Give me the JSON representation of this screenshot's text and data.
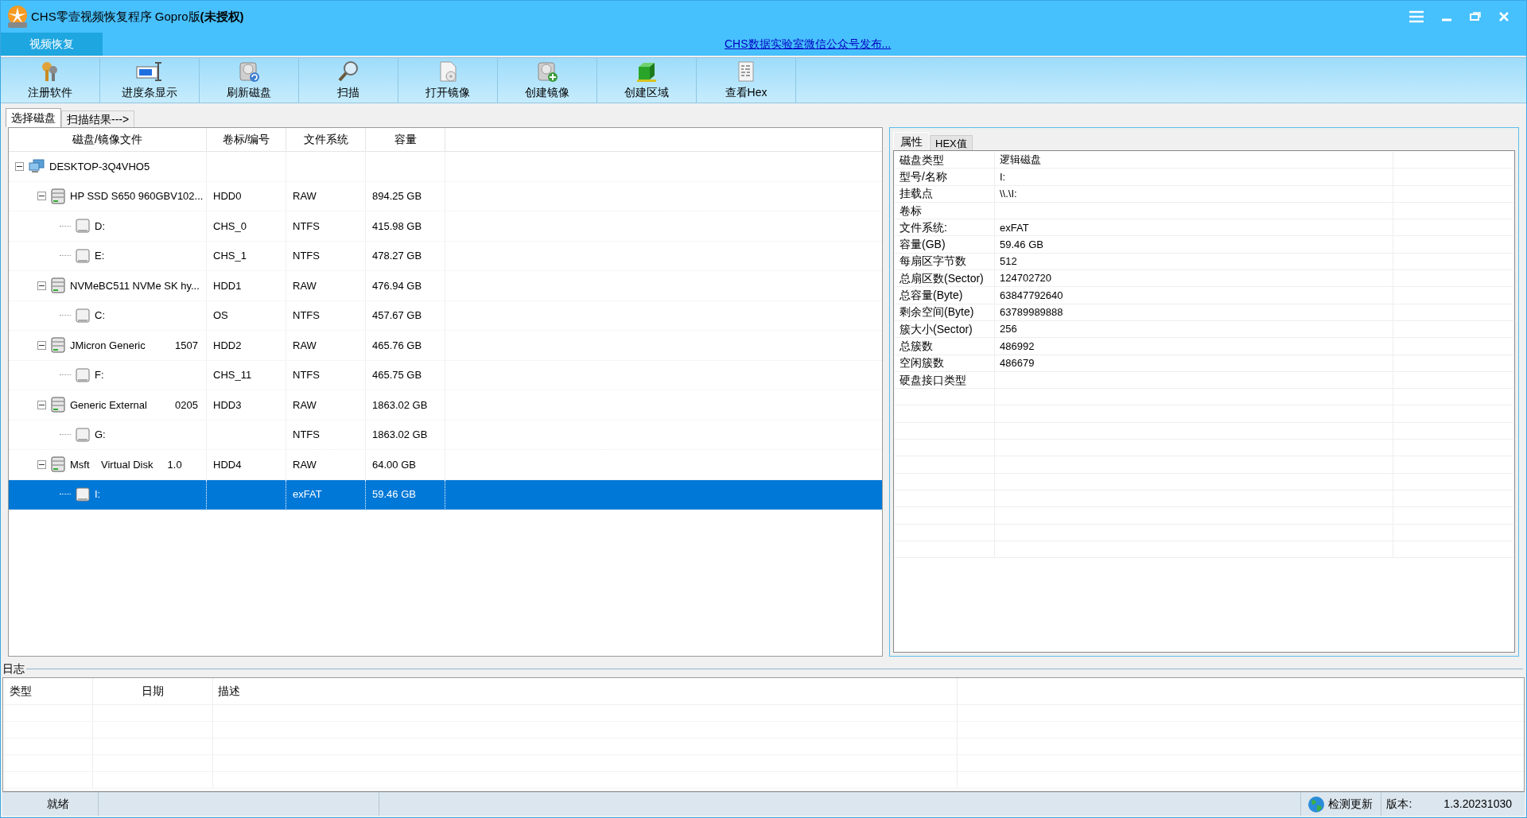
{
  "window": {
    "title": "CHS零壹视频恢复程序 Gopro版",
    "title_suffix": "(未授权)"
  },
  "nav_tabs": [
    {
      "label": "视频恢复",
      "selected": true
    }
  ],
  "link": "CHS数据实验室微信公众号发布...",
  "toolbar": [
    "注册软件",
    "进度条显示",
    "刷新磁盘",
    "扫描",
    "打开镜像",
    "创建镜像",
    "创建区域",
    "查看Hex"
  ],
  "tabs": [
    {
      "label": "选择磁盘",
      "selected": true
    },
    {
      "label": "扫描结果--->",
      "selected": false
    }
  ],
  "disk_table": {
    "columns": [
      "磁盘/镜像文件",
      "卷标/编号",
      "文件系统",
      "容量"
    ],
    "tree": [
      {
        "kind": "computer",
        "name": "DESKTOP-3Q4VHO5",
        "expanded": true,
        "selected": false,
        "children": [
          {
            "kind": "disk",
            "name": "HP SSD S650 960GBV102...",
            "label": "HDD0",
            "fs": "RAW",
            "size": "894.25 GB",
            "expanded": true,
            "selected": false,
            "children": [
              {
                "kind": "volume",
                "name": "D:",
                "label": "CHS_0",
                "fs": "NTFS",
                "size": "415.98 GB",
                "selected": false
              },
              {
                "kind": "volume",
                "name": "E:",
                "label": "CHS_1",
                "fs": "NTFS",
                "size": "478.27 GB",
                "selected": false
              }
            ]
          },
          {
            "kind": "disk",
            "name": "NVMeBC511 NVMe SK hy...",
            "label": "HDD1",
            "fs": "RAW",
            "size": "476.94 GB",
            "expanded": true,
            "selected": false,
            "children": [
              {
                "kind": "volume",
                "name": "C:",
                "label": "OS",
                "fs": "NTFS",
                "size": "457.67 GB",
                "selected": false
              }
            ]
          },
          {
            "kind": "disk",
            "name": "JMicron Generic",
            "name_suffix": "1507",
            "label": "HDD2",
            "fs": "RAW",
            "size": "465.76 GB",
            "expanded": true,
            "selected": false,
            "children": [
              {
                "kind": "volume",
                "name": "F:",
                "label": "CHS_11",
                "fs": "NTFS",
                "size": "465.75 GB",
                "selected": false
              }
            ]
          },
          {
            "kind": "disk",
            "name": "Generic External",
            "name_suffix": "0205",
            "label": "HDD3",
            "fs": "RAW",
            "size": "1863.02 GB",
            "expanded": true,
            "selected": false,
            "children": [
              {
                "kind": "volume",
                "name": "G:",
                "fs": "NTFS",
                "size": "1863.02 GB",
                "selected": false
              }
            ]
          },
          {
            "kind": "disk",
            "name": "Msft    Virtual Disk     1.0",
            "label": "HDD4",
            "fs": "RAW",
            "size": "64.00 GB",
            "expanded": true,
            "selected": false,
            "children": [
              {
                "kind": "volume",
                "name": "I:",
                "fs": "exFAT",
                "size": "59.46 GB",
                "selected": true
              }
            ]
          }
        ]
      }
    ]
  },
  "detail_tabs": [
    {
      "label": "属性",
      "selected": true
    },
    {
      "label": "HEX值",
      "selected": false
    }
  ],
  "properties": [
    {
      "name": "磁盘类型",
      "value": "逻辑磁盘"
    },
    {
      "name": "型号/名称",
      "value": "I:"
    },
    {
      "name": "挂载点",
      "value": "\\\\.\\I:"
    },
    {
      "name": "卷标"
    },
    {
      "name": "文件系统:",
      "value": "exFAT"
    },
    {
      "name": "容量(GB)",
      "value": "59.46 GB"
    },
    {
      "name": "每扇区字节数",
      "value": "512"
    },
    {
      "name": "总扇区数(Sector)",
      "value": "124702720"
    },
    {
      "name": "总容量(Byte)",
      "value": "63847792640"
    },
    {
      "name": "剩余空间(Byte)",
      "value": "63789989888"
    },
    {
      "name": "簇大小(Sector)",
      "value": "256"
    },
    {
      "name": "总簇数",
      "value": "486992"
    },
    {
      "name": "空闲簇数",
      "value": "486679"
    },
    {
      "name": "硬盘接口类型"
    }
  ],
  "log": {
    "title": "日志",
    "columns": [
      "类型",
      "日期",
      "描述"
    ]
  },
  "status_bar": {
    "status": "就绪",
    "update": "检测更新",
    "version_label": "版本:",
    "version": "1.3.20231030"
  }
}
